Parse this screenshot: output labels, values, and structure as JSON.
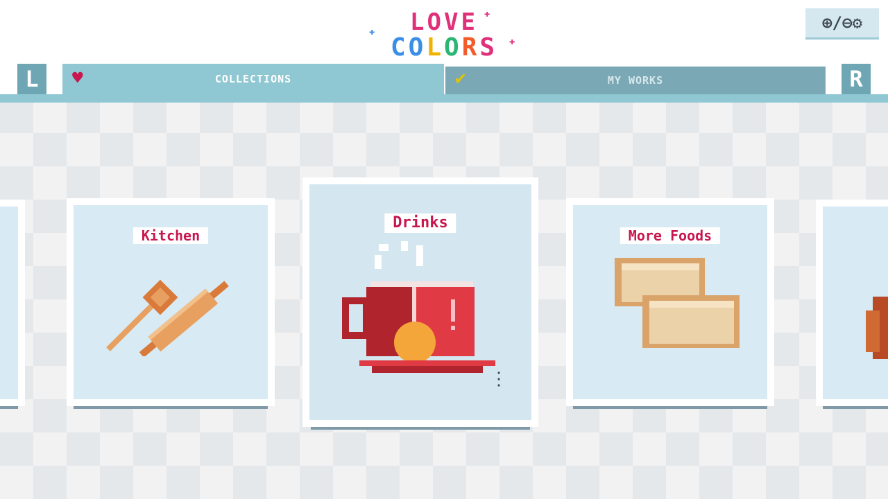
{
  "logo": {
    "line1": "LOVE",
    "line2": [
      "C",
      "O",
      "L",
      "O",
      "R",
      "S"
    ],
    "line2_colors": [
      "#3a8ee6",
      "#3a8ee6",
      "#f0b400",
      "#2bb673",
      "#f25c2a",
      "#e0307a"
    ]
  },
  "zoom": {
    "label": "⊕/⊖⚙"
  },
  "shoulders": {
    "left": "L",
    "right": "R"
  },
  "tabs": [
    {
      "label": "COLLECTIONS",
      "icon": "heart-icon",
      "active": true
    },
    {
      "label": "MY WORKS",
      "icon": "check-icon",
      "active": false
    }
  ],
  "cards": [
    {
      "title": "Kitchen",
      "icon": "kitchen-utensils-art"
    },
    {
      "title": "Drinks",
      "icon": "tea-cup-art",
      "selected": true
    },
    {
      "title": "More Foods",
      "icon": "dumplings-art"
    }
  ],
  "colors": {
    "tab_active": "#8fc7d3",
    "tab_inactive": "#7aa8b4",
    "label_text": "#c8174f",
    "card_bg": "#d8eaf3"
  }
}
